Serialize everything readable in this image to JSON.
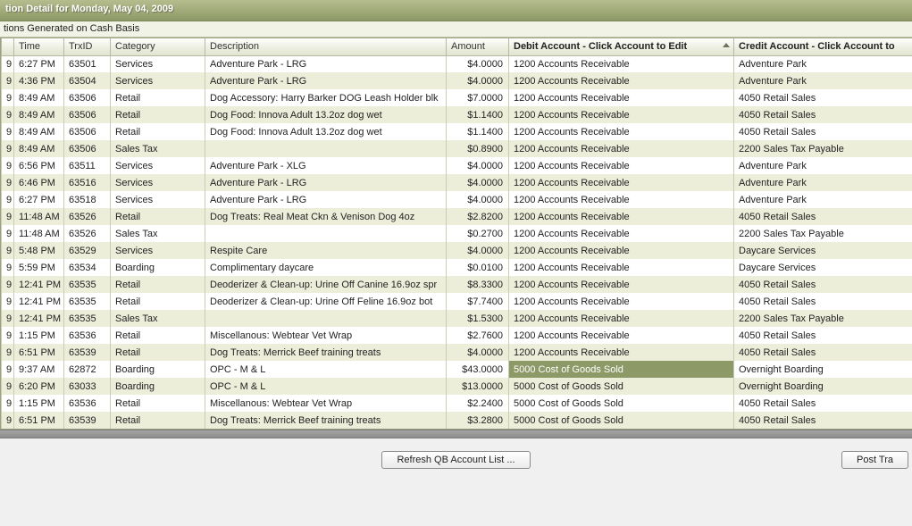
{
  "window": {
    "title": "tion Detail for Monday, May 04, 2009",
    "subtitle": "tions Generated on Cash Basis"
  },
  "columns": {
    "date": "9",
    "time": "Time",
    "trxid": "TrxID",
    "category": "Category",
    "description": "Description",
    "amount": "Amount",
    "debit": "Debit Account - Click Account to Edit",
    "credit": "Credit Account - Click Account to"
  },
  "buttons": {
    "refresh": "Refresh QB Account List ...",
    "post": "Post Tra"
  },
  "rows": [
    {
      "date": "9",
      "time": "6:27 PM",
      "trx": "63501",
      "cat": "Services",
      "desc": "Adventure Park - LRG",
      "amt": "$4.0000",
      "debit": "1200 Accounts Receivable",
      "credit": " Adventure Park"
    },
    {
      "date": "9",
      "time": "4:36 PM",
      "trx": "63504",
      "cat": "Services",
      "desc": "Adventure Park - LRG",
      "amt": "$4.0000",
      "debit": "1200 Accounts Receivable",
      "credit": " Adventure Park"
    },
    {
      "date": "9",
      "time": "8:49 AM",
      "trx": "63506",
      "cat": "Retail",
      "desc": "Dog Accessory: Harry Barker DOG Leash Holder blk",
      "amt": "$7.0000",
      "debit": "1200 Accounts Receivable",
      "credit": "4050 Retail Sales"
    },
    {
      "date": "9",
      "time": "8:49 AM",
      "trx": "63506",
      "cat": "Retail",
      "desc": "Dog Food: Innova Adult 13.2oz dog wet",
      "amt": "$1.1400",
      "debit": "1200 Accounts Receivable",
      "credit": "4050 Retail Sales"
    },
    {
      "date": "9",
      "time": "8:49 AM",
      "trx": "63506",
      "cat": "Retail",
      "desc": "Dog Food: Innova Adult 13.2oz dog wet",
      "amt": "$1.1400",
      "debit": "1200 Accounts Receivable",
      "credit": "4050 Retail Sales"
    },
    {
      "date": "9",
      "time": "8:49 AM",
      "trx": "63506",
      "cat": "Sales Tax",
      "desc": "",
      "amt": "$0.8900",
      "debit": "1200 Accounts Receivable",
      "credit": "2200 Sales Tax Payable"
    },
    {
      "date": "9",
      "time": "6:56 PM",
      "trx": "63511",
      "cat": "Services",
      "desc": "Adventure Park - XLG",
      "amt": "$4.0000",
      "debit": "1200 Accounts Receivable",
      "credit": " Adventure Park"
    },
    {
      "date": "9",
      "time": "6:46 PM",
      "trx": "63516",
      "cat": "Services",
      "desc": "Adventure Park - LRG",
      "amt": "$4.0000",
      "debit": "1200 Accounts Receivable",
      "credit": " Adventure Park"
    },
    {
      "date": "9",
      "time": "6:27 PM",
      "trx": "63518",
      "cat": "Services",
      "desc": "Adventure Park - LRG",
      "amt": "$4.0000",
      "debit": "1200 Accounts Receivable",
      "credit": " Adventure Park"
    },
    {
      "date": "9",
      "time": "11:48 AM",
      "trx": "63526",
      "cat": "Retail",
      "desc": "Dog Treats: Real Meat Ckn & Venison Dog 4oz",
      "amt": "$2.8200",
      "debit": "1200 Accounts Receivable",
      "credit": "4050 Retail Sales"
    },
    {
      "date": "9",
      "time": "11:48 AM",
      "trx": "63526",
      "cat": "Sales Tax",
      "desc": "",
      "amt": "$0.2700",
      "debit": "1200 Accounts Receivable",
      "credit": "2200 Sales Tax Payable"
    },
    {
      "date": "9",
      "time": "5:48 PM",
      "trx": "63529",
      "cat": "Services",
      "desc": "Respite Care",
      "amt": "$4.0000",
      "debit": "1200 Accounts Receivable",
      "credit": " Daycare Services"
    },
    {
      "date": "9",
      "time": "5:59 PM",
      "trx": "63534",
      "cat": "Boarding",
      "desc": "Complimentary daycare",
      "amt": "$0.0100",
      "debit": "1200 Accounts Receivable",
      "credit": " Daycare Services"
    },
    {
      "date": "9",
      "time": "12:41 PM",
      "trx": "63535",
      "cat": "Retail",
      "desc": "Deoderizer & Clean-up: Urine Off Canine 16.9oz spr",
      "amt": "$8.3300",
      "debit": "1200 Accounts Receivable",
      "credit": "4050 Retail Sales"
    },
    {
      "date": "9",
      "time": "12:41 PM",
      "trx": "63535",
      "cat": "Retail",
      "desc": "Deoderizer & Clean-up: Urine Off Feline 16.9oz bot",
      "amt": "$7.7400",
      "debit": "1200 Accounts Receivable",
      "credit": "4050 Retail Sales"
    },
    {
      "date": "9",
      "time": "12:41 PM",
      "trx": "63535",
      "cat": "Sales Tax",
      "desc": "",
      "amt": "$1.5300",
      "debit": "1200 Accounts Receivable",
      "credit": "2200 Sales Tax Payable"
    },
    {
      "date": "9",
      "time": "1:15 PM",
      "trx": "63536",
      "cat": "Retail",
      "desc": "Miscellanous: Webtear Vet Wrap",
      "amt": "$2.7600",
      "debit": "1200 Accounts Receivable",
      "credit": "4050 Retail Sales"
    },
    {
      "date": "9",
      "time": "6:51 PM",
      "trx": "63539",
      "cat": "Retail",
      "desc": "Dog Treats: Merrick Beef training treats",
      "amt": "$4.0000",
      "debit": "1200 Accounts Receivable",
      "credit": "4050 Retail Sales"
    },
    {
      "date": "9",
      "time": "9:37 AM",
      "trx": "62872",
      "cat": "Boarding",
      "desc": "OPC - M & L",
      "amt": "$43.0000",
      "debit": "5000 Cost of Goods Sold",
      "credit": " Overnight Boarding",
      "selected": true
    },
    {
      "date": "9",
      "time": "6:20 PM",
      "trx": "63033",
      "cat": "Boarding",
      "desc": "OPC - M & L",
      "amt": "$13.0000",
      "debit": "5000 Cost of Goods Sold",
      "credit": " Overnight Boarding"
    },
    {
      "date": "9",
      "time": "1:15 PM",
      "trx": "63536",
      "cat": "Retail",
      "desc": "Miscellanous: Webtear Vet Wrap",
      "amt": "$2.2400",
      "debit": "5000 Cost of Goods Sold",
      "credit": "4050 Retail Sales"
    },
    {
      "date": "9",
      "time": "6:51 PM",
      "trx": "63539",
      "cat": "Retail",
      "desc": "Dog Treats: Merrick Beef training treats",
      "amt": "$3.2800",
      "debit": "5000 Cost of Goods Sold",
      "credit": "4050 Retail Sales"
    }
  ],
  "colors": {
    "accent": "#8e9968",
    "alt_row": "#edeeda"
  }
}
